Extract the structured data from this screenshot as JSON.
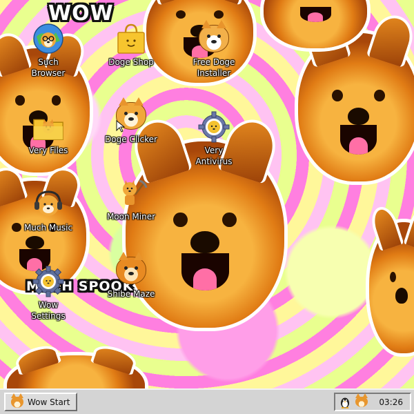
{
  "wallpaper": {
    "top_text": "WOW",
    "mid_text": "MUCH SPOOK"
  },
  "desktop_icons": [
    {
      "id": "such-browser",
      "label": "Such\nBrowser",
      "icon": "doge-glasses-globe-icon"
    },
    {
      "id": "doge-shop",
      "label": "Doge Shop",
      "icon": "shopping-bag-icon"
    },
    {
      "id": "free-doge-installer",
      "label": "Free Doge\nInstaller",
      "icon": "shibe-installer-icon"
    },
    {
      "id": "very-files",
      "label": "Very Files",
      "icon": "folder-icon"
    },
    {
      "id": "doge-clicker",
      "label": "Doge Clicker",
      "icon": "doge-cursor-icon"
    },
    {
      "id": "very-antivirus",
      "label": "Very\nAntivirus",
      "icon": "gear-shield-icon"
    },
    {
      "id": "much-music",
      "label": "Much Music",
      "icon": "headphones-icon"
    },
    {
      "id": "moon-miner",
      "label": "Moon Miner",
      "icon": "pickaxe-icon"
    },
    {
      "id": "wow-settings",
      "label": "Wow\nSettings",
      "icon": "gear-icon"
    },
    {
      "id": "shibe-maze",
      "label": "Shibe Maze",
      "icon": "maze-shibe-icon"
    }
  ],
  "taskbar": {
    "start_label": "Wow Start",
    "clock": "03:26",
    "tray_icons": [
      "penguin-icon",
      "shibe-icon"
    ]
  },
  "colors": {
    "taskbar_bg": "#d4d4d4",
    "wallpaper_pink": "#ff7fe0",
    "wallpaper_yellow": "#fff79a"
  }
}
